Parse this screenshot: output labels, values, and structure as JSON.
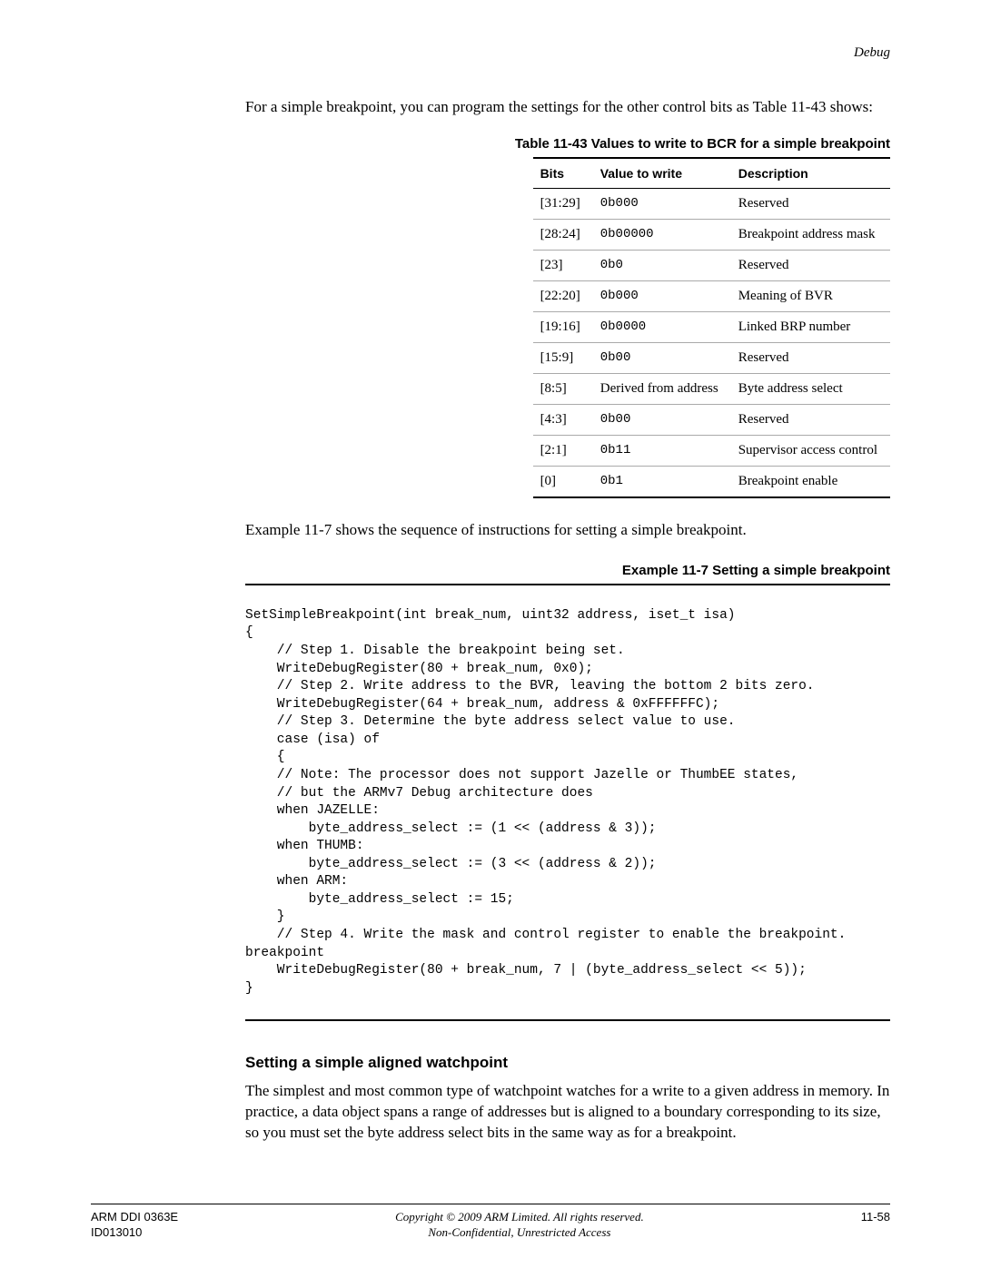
{
  "header": {
    "section": "Debug"
  },
  "intro": "For a simple breakpoint, you can program the settings for the other control bits as Table 11-43 shows:",
  "table": {
    "caption": "Table 11-43 Values to write to BCR for a simple breakpoint",
    "headers": [
      "Bits",
      "Value to write",
      "Description"
    ],
    "rows": [
      {
        "bits": "[31:29]",
        "value": "0b000",
        "mono": true,
        "desc": "Reserved"
      },
      {
        "bits": "[28:24]",
        "value": "0b00000",
        "mono": true,
        "desc": "Breakpoint address mask"
      },
      {
        "bits": "[23]",
        "value": "0b0",
        "mono": true,
        "desc": "Reserved"
      },
      {
        "bits": "[22:20]",
        "value": "0b000",
        "mono": true,
        "desc": "Meaning of BVR"
      },
      {
        "bits": "[19:16]",
        "value": "0b0000",
        "mono": true,
        "desc": "Linked BRP number"
      },
      {
        "bits": "[15:9]",
        "value": "0b00",
        "mono": true,
        "desc": "Reserved"
      },
      {
        "bits": "[8:5]",
        "value": "Derived from address",
        "mono": false,
        "desc": "Byte address select"
      },
      {
        "bits": "[4:3]",
        "value": "0b00",
        "mono": true,
        "desc": "Reserved"
      },
      {
        "bits": "[2:1]",
        "value": "0b11",
        "mono": true,
        "desc": "Supervisor access control"
      },
      {
        "bits": "[0]",
        "value": "0b1",
        "mono": true,
        "desc": "Breakpoint enable"
      }
    ]
  },
  "mid_text": "Example 11-7 shows the sequence of instructions for setting a simple breakpoint.",
  "example": {
    "caption": "Example 11-7 Setting a simple breakpoint",
    "code": "SetSimpleBreakpoint(int break_num, uint32 address, iset_t isa)\n{\n    // Step 1. Disable the breakpoint being set.\n    WriteDebugRegister(80 + break_num, 0x0);\n    // Step 2. Write address to the BVR, leaving the bottom 2 bits zero.\n    WriteDebugRegister(64 + break_num, address & 0xFFFFFFC);\n    // Step 3. Determine the byte address select value to use.\n    case (isa) of\n    {\n    // Note: The processor does not support Jazelle or ThumbEE states,\n    // but the ARMv7 Debug architecture does\n    when JAZELLE:\n        byte_address_select := (1 << (address & 3));\n    when THUMB:\n        byte_address_select := (3 << (address & 2));\n    when ARM:\n        byte_address_select := 15;\n    }\n    // Step 4. Write the mask and control register to enable the breakpoint.\nbreakpoint\n    WriteDebugRegister(80 + break_num, 7 | (byte_address_select << 5));\n}"
  },
  "subsection": {
    "title": "Setting a simple aligned watchpoint",
    "body": "The simplest and most common type of watchpoint watches for a write to a given address in memory. In practice, a data object spans a range of addresses but is aligned to a boundary corresponding to its size, so you must set the byte address select bits in the same way as for a breakpoint."
  },
  "footer": {
    "left1": "ARM DDI 0363E",
    "left2": "ID013010",
    "center1": "Copyright © 2009 ARM Limited. All rights reserved.",
    "center2": "Non-Confidential, Unrestricted Access",
    "right": "11-58"
  }
}
